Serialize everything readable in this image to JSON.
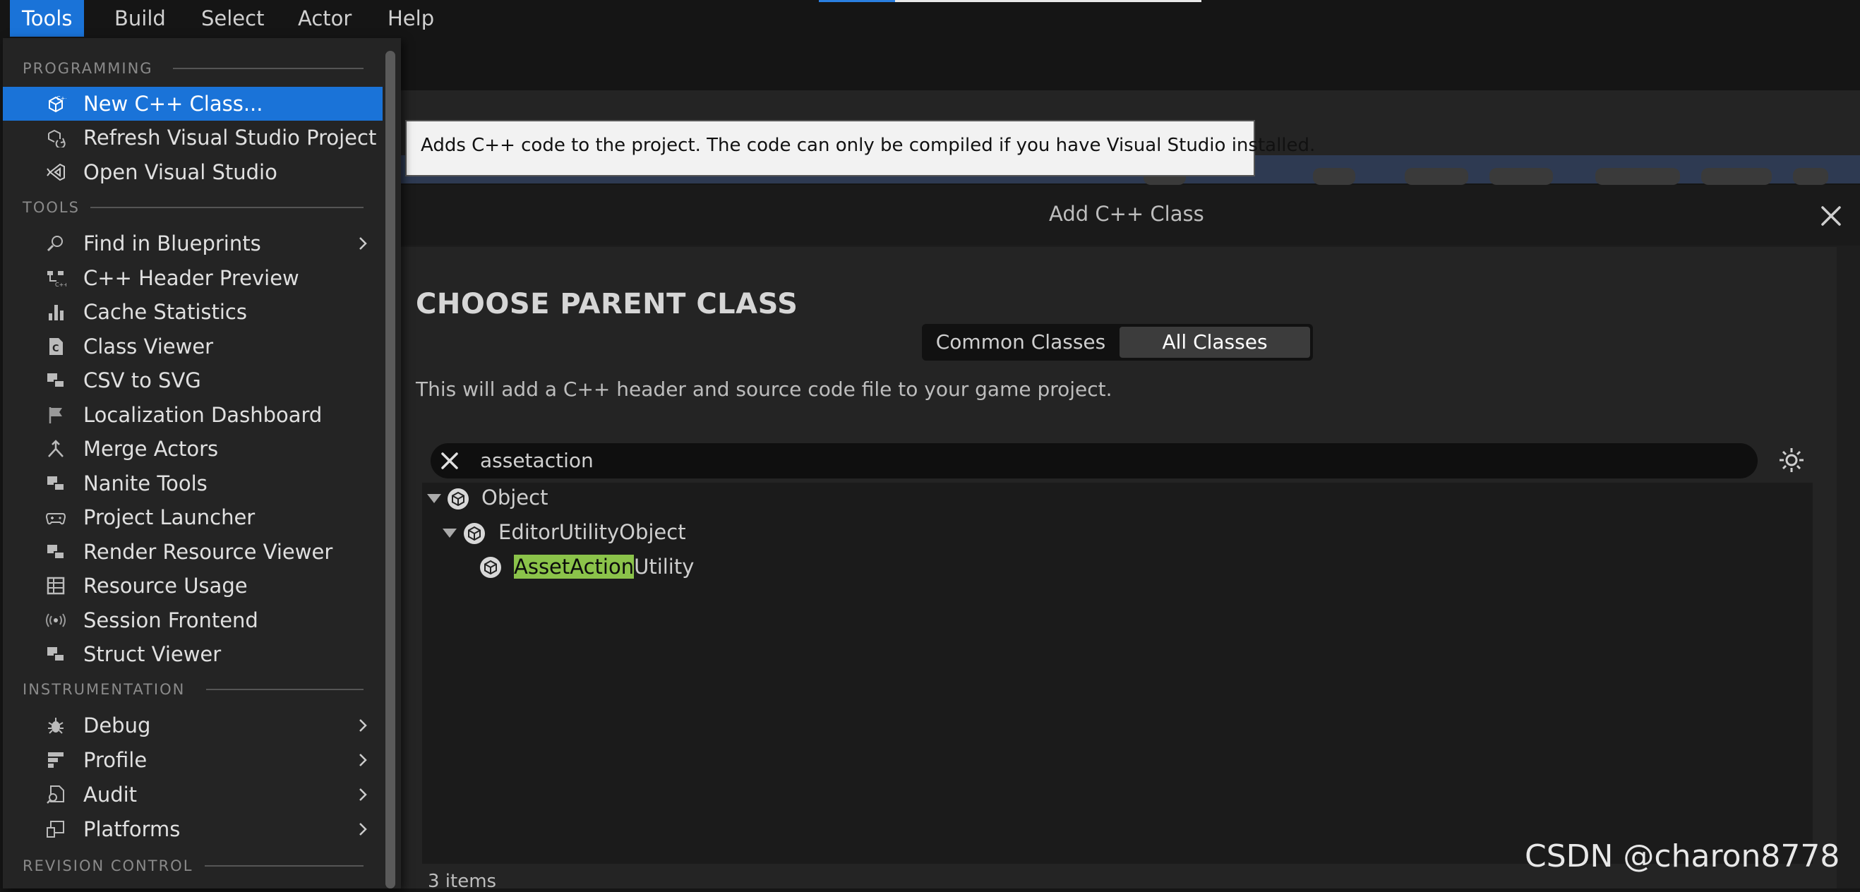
{
  "menubar": {
    "items": [
      {
        "label": "Tools",
        "active": true
      },
      {
        "label": "Build"
      },
      {
        "label": "Select"
      },
      {
        "label": "Actor"
      },
      {
        "label": "Help"
      }
    ]
  },
  "dropdown": {
    "sections": {
      "programming": "PROGRAMMING",
      "tools": "TOOLS",
      "instrumentation": "INSTRUMENTATION",
      "revision": "REVISION CONTROL"
    },
    "programming_items": [
      {
        "label": "New C++ Class...",
        "icon": "cpp-class-icon"
      },
      {
        "label": "Refresh Visual Studio Project",
        "icon": "refresh-project-icon"
      },
      {
        "label": "Open Visual Studio",
        "icon": "visual-studio-icon"
      }
    ],
    "tools_items": [
      {
        "label": "Find in Blueprints",
        "icon": "find-icon"
      },
      {
        "label": "C++ Header Preview",
        "icon": "header-preview-icon"
      },
      {
        "label": "Cache Statistics",
        "icon": "bar-chart-icon"
      },
      {
        "label": "Class Viewer",
        "icon": "class-viewer-icon"
      },
      {
        "label": "CSV to SVG",
        "icon": "csv-svg-icon"
      },
      {
        "label": "Localization Dashboard",
        "icon": "flag-icon"
      },
      {
        "label": "Merge Actors",
        "icon": "merge-icon"
      },
      {
        "label": "Nanite Tools",
        "icon": "nanite-icon"
      },
      {
        "label": "Project Launcher",
        "icon": "gamepad-icon"
      },
      {
        "label": "Render Resource Viewer",
        "icon": "render-resource-icon"
      },
      {
        "label": "Resource Usage",
        "icon": "table-icon"
      },
      {
        "label": "Session Frontend",
        "icon": "broadcast-icon"
      },
      {
        "label": "Struct Viewer",
        "icon": "struct-icon"
      }
    ],
    "instrumentation_items": [
      {
        "label": "Debug",
        "icon": "bug-icon"
      },
      {
        "label": "Profile",
        "icon": "profile-icon"
      },
      {
        "label": "Audit",
        "icon": "audit-icon"
      },
      {
        "label": "Platforms",
        "icon": "platforms-icon"
      }
    ]
  },
  "tooltip": {
    "text": "Adds C++ code to the project. The code can only be compiled if you have Visual Studio installed."
  },
  "dialog": {
    "title": "Add C++ Class",
    "heading": "CHOOSE PARENT CLASS",
    "tabs": {
      "common": "Common Classes",
      "all": "All Classes"
    },
    "description": "This will add a C++ header and source code file to your game project.",
    "search": {
      "value": "assetaction"
    },
    "tree": {
      "root": "Object",
      "child": "EditorUtilityObject",
      "leaf_match": "AssetAction",
      "leaf_rest": "Utility"
    },
    "item_count": "3 items"
  },
  "watermark": "CSDN @charon8778",
  "colors": {
    "accent": "#1a73d8",
    "highlight": "#8bc34a",
    "dialog_bg": "#242424"
  }
}
